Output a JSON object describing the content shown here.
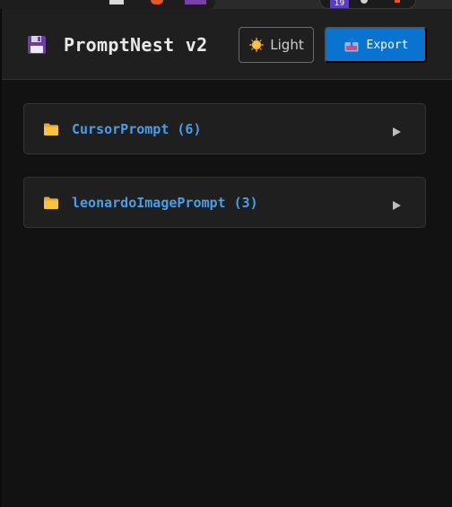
{
  "browser": {
    "extension_badge": "19"
  },
  "header": {
    "app_icon": "floppy-disk-icon",
    "title": "PromptNest v2",
    "theme_button": {
      "icon": "sun-icon",
      "label": "Light"
    },
    "export_button": {
      "icon": "upload-tray-icon",
      "label": "Export"
    }
  },
  "folders": [
    {
      "icon": "folder-icon",
      "name": "CursorPrompt",
      "count": "(6)",
      "label": "CursorPrompt (6)",
      "expanded": false
    },
    {
      "icon": "folder-icon",
      "name": "leonardoImagePrompt",
      "count": "(3)",
      "label": "leonardoImagePrompt (3)",
      "expanded": false
    }
  ],
  "colors": {
    "background": "#121212",
    "panel": "#1f1f1f",
    "accent_blue": "#0a72cf",
    "folder_text": "#4a9de8",
    "folder_yellow": "#f5c542",
    "title_text": "#e8e8e8"
  }
}
